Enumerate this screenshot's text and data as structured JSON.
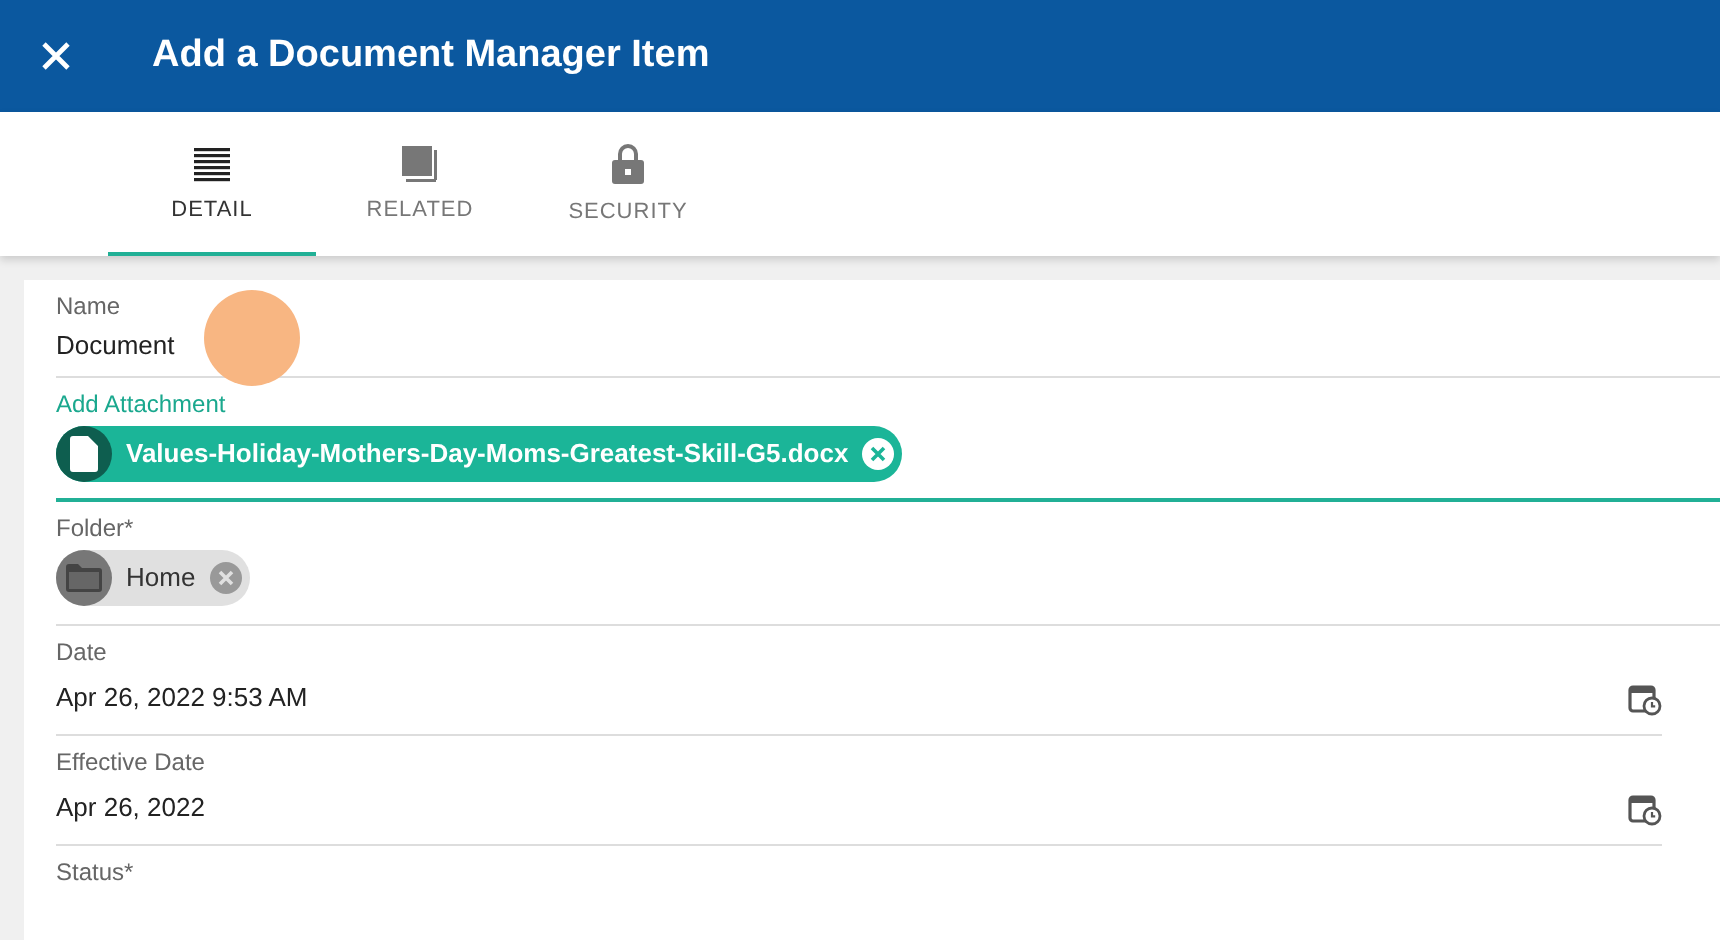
{
  "header": {
    "title": "Add a Document Manager Item"
  },
  "tabs": [
    {
      "label": "DETAIL",
      "kind": "lines",
      "selected": true
    },
    {
      "label": "RELATED",
      "kind": "square",
      "selected": false
    },
    {
      "label": "SECURITY",
      "kind": "lock",
      "selected": false
    }
  ],
  "fields": [
    {
      "kind": "text",
      "label": "Name",
      "value": "Document",
      "focused": false
    },
    {
      "kind": "attachment",
      "label": "Add Attachment",
      "chip": "Values-Holiday-Mothers-Day-Moms-Greatest-Skill-G5.docx",
      "focused": true
    },
    {
      "kind": "folder",
      "label": "Folder*",
      "chip": "Home",
      "focused": false
    },
    {
      "kind": "date",
      "label": "Date",
      "value": "Apr 26, 2022 9:53 AM",
      "focused": false
    },
    {
      "kind": "date",
      "label": "Effective Date",
      "value": "Apr 26, 2022",
      "focused": false
    },
    {
      "kind": "label",
      "label": "Status*",
      "focused": false
    }
  ]
}
